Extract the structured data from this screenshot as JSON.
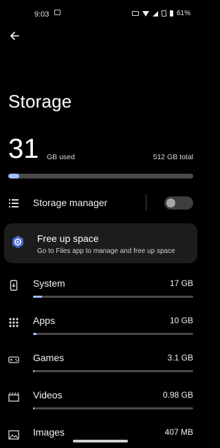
{
  "status_bar": {
    "time": "9:03",
    "battery": "61%"
  },
  "page": {
    "title": "Storage"
  },
  "summary": {
    "used_number": "31",
    "used_unit": "GB used",
    "total": "512 GB total",
    "used_fraction": 0.06
  },
  "storage_manager": {
    "label": "Storage manager",
    "enabled": false
  },
  "free_up": {
    "title": "Free up space",
    "subtitle": "Go to Files app to manage and free up space"
  },
  "categories": [
    {
      "label": "System",
      "value": "17 GB",
      "fraction": 0.055,
      "icon": "system-icon"
    },
    {
      "label": "Apps",
      "value": "10 GB",
      "fraction": 0.02,
      "icon": "apps-icon"
    },
    {
      "label": "Games",
      "value": "3.1 GB",
      "fraction": 0.01,
      "icon": "games-icon"
    },
    {
      "label": "Videos",
      "value": "0.98 GB",
      "fraction": 0.004,
      "icon": "videos-icon"
    },
    {
      "label": "Images",
      "value": "407 MB",
      "fraction": 0.002,
      "icon": "images-icon"
    }
  ],
  "colors": {
    "accent": "#9dc0ff",
    "track": "#4a4a4a",
    "background": "#000000",
    "card": "#1c1c1c"
  }
}
